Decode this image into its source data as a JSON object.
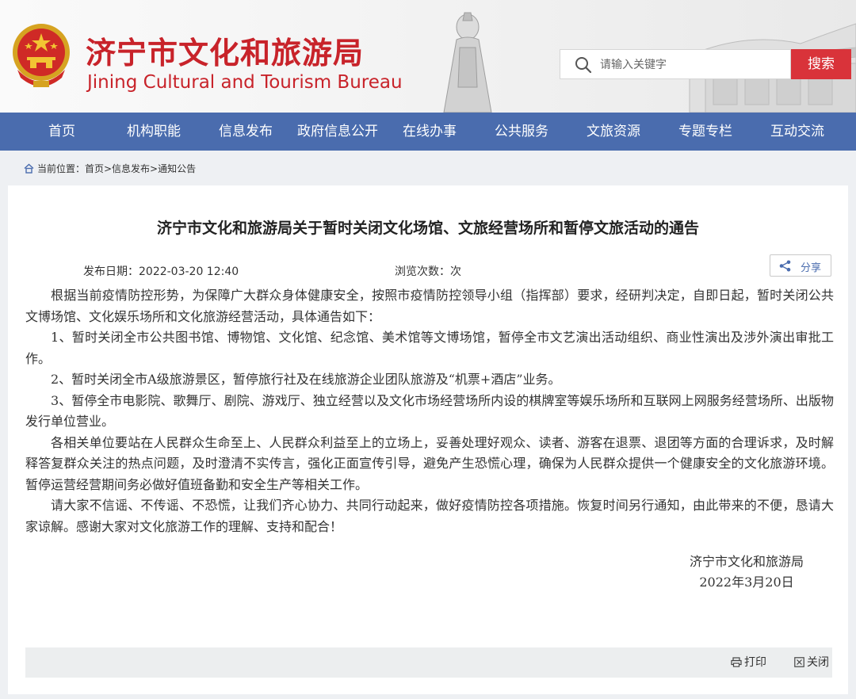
{
  "header": {
    "title_cn": "济宁市文化和旅游局",
    "title_en": "Jining Cultural and Tourism Bureau",
    "emblem_icon": "national-emblem-icon",
    "search": {
      "placeholder": "请输入关键字",
      "button_label": "搜索"
    },
    "colors": {
      "brand_red": "#c8232a",
      "nav_blue": "#4a6cae",
      "search_red": "#d9333a"
    }
  },
  "nav": {
    "items": [
      "首页",
      "机构职能",
      "信息发布",
      "政府信息公开",
      "在线办事",
      "公共服务",
      "文旅资源",
      "专题专栏",
      "互动交流"
    ]
  },
  "breadcrumb": {
    "icon": "home-icon",
    "text": "当前位置：首页>信息发布>通知公告"
  },
  "article": {
    "title": "济宁市文化和旅游局关于暂时关闭文化场馆、文旅经营场所和暂停文旅活动的通告",
    "publish_date": "发布日期：2022-03-20 12:40",
    "views": "浏览次数：次",
    "share_label": "分享",
    "paragraphs": [
      "根据当前疫情防控形势，为保障广大群众身体健康安全，按照市疫情防控领导小组（指挥部）要求，经研判决定，自即日起，暂时关闭公共文博场馆、文化娱乐场所和文化旅游经营活动，具体通告如下：",
      "1、暂时关闭全市公共图书馆、博物馆、文化馆、纪念馆、美术馆等文博场馆，暂停全市文艺演出活动组织、商业性演出及涉外演出审批工作。",
      "2、暂时关闭全市A级旅游景区，暂停旅行社及在线旅游企业团队旅游及“机票+酒店”业务。",
      "3、暂停全市电影院、歌舞厅、剧院、游戏厅、独立经营以及文化市场经营场所内设的棋牌室等娱乐场所和互联网上网服务经营场所、出版物发行单位营业。",
      "各相关单位要站在人民群众生命至上、人民群众利益至上的立场上，妥善处理好观众、读者、游客在退票、退团等方面的合理诉求，及时解释答复群众关注的热点问题，及时澄清不实传言，强化正面宣传引导，避免产生恐慌心理，确保为人民群众提供一个健康安全的文化旅游环境。暂停运营经营期间务必做好值班备勤和安全生产等相关工作。",
      "请大家不信谣、不传谣、不恐慌，让我们齐心协力、共同行动起来，做好疫情防控各项措施。恢复时间另行通知，由此带来的不便，恳请大家谅解。感谢大家对文化旅游工作的理解、支持和配合！"
    ],
    "signature": {
      "org": "济宁市文化和旅游局",
      "date": "2022年3月20日"
    }
  },
  "tools": {
    "print_label": "打印",
    "close_label": "关闭"
  }
}
